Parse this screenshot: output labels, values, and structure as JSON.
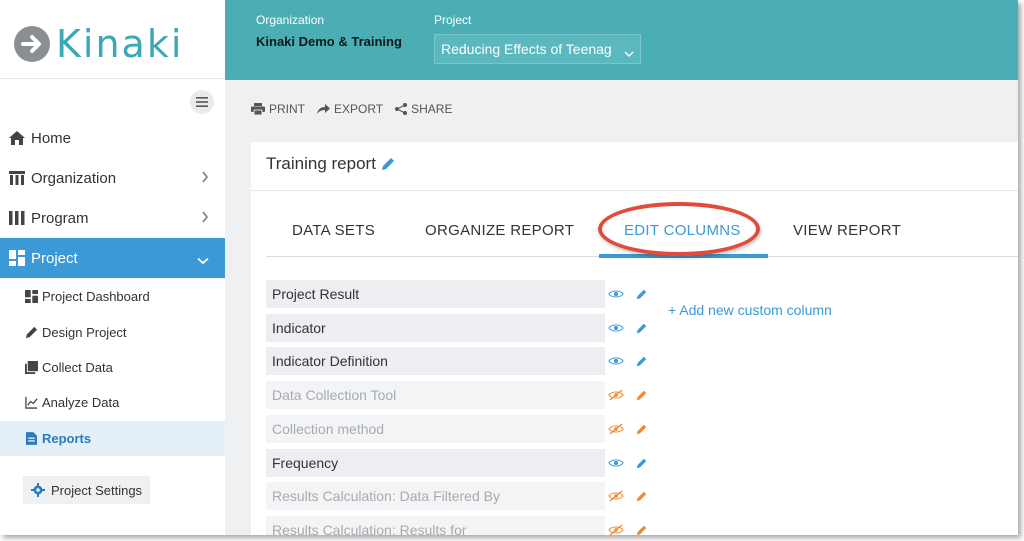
{
  "app": {
    "logo_text": "Kinaki",
    "accent_color": "#3a99d6",
    "header_color": "#4aaeb4",
    "highlight_color": "#e24a3b"
  },
  "sidebar": {
    "nav": [
      {
        "label": "Home",
        "icon": "home-icon"
      },
      {
        "label": "Organization",
        "icon": "organization-icon"
      },
      {
        "label": "Program",
        "icon": "program-icon"
      },
      {
        "label": "Project",
        "icon": "project-icon",
        "active": true
      }
    ],
    "sub": [
      {
        "label": "Project Dashboard",
        "icon": "dashboard-icon"
      },
      {
        "label": "Design Project",
        "icon": "pencil-icon"
      },
      {
        "label": "Collect Data",
        "icon": "collect-icon"
      },
      {
        "label": "Analyze Data",
        "icon": "chart-icon"
      },
      {
        "label": "Reports",
        "icon": "document-icon",
        "active": true
      }
    ],
    "settings_label": "Project Settings"
  },
  "header": {
    "org_label": "Organization",
    "org_value": "Kinaki Demo & Training",
    "project_label": "Project",
    "project_value": "Reducing Effects of Teenag"
  },
  "toolbar": {
    "print": "PRINT",
    "export": "EXPORT",
    "share": "SHARE"
  },
  "report": {
    "title": "Training report",
    "tabs": [
      "DATA SETS",
      "ORGANIZE REPORT",
      "EDIT COLUMNS",
      "VIEW REPORT"
    ],
    "active_tab": "EDIT COLUMNS",
    "columns": [
      {
        "label": "Project Result",
        "visible": true
      },
      {
        "label": "Indicator",
        "visible": true
      },
      {
        "label": "Indicator Definition",
        "visible": true
      },
      {
        "label": "Data Collection Tool",
        "visible": false
      },
      {
        "label": "Collection method",
        "visible": false
      },
      {
        "label": "Frequency",
        "visible": true
      },
      {
        "label": "Results Calculation: Data Filtered By",
        "visible": false
      },
      {
        "label": "Results Calculation: Results for",
        "visible": false
      }
    ],
    "add_column_label": "+ Add new custom column"
  }
}
